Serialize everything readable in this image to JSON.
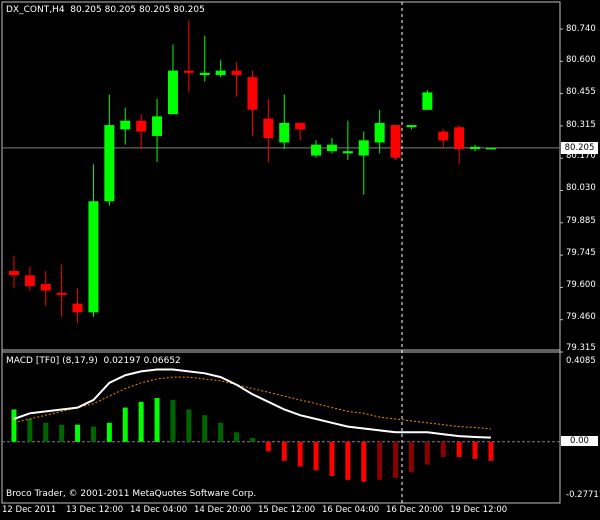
{
  "chart": {
    "symbol_line": "DX_CONT,H4  80.205 80.205 80.205 80.205",
    "current_price": "80.205",
    "price_axis": [
      "80.740",
      "80.600",
      "80.455",
      "80.315",
      "80.170",
      "80.030",
      "79.885",
      "79.745",
      "79.600",
      "79.460",
      "79.315"
    ],
    "time_axis": [
      "12 Dec 2011",
      "13 Dec 12:00",
      "14 Dec 04:00",
      "14 Dec 20:00",
      "15 Dec 12:00",
      "16 Dec 04:00",
      "16 Dec 20:00",
      "19 Dec 12:00"
    ],
    "colors": {
      "bull": "#00ff00",
      "bear": "#ff0000",
      "grid": "#808080",
      "background": "#000000"
    }
  },
  "indicator": {
    "label": "MACD [TF0] (8,17,9)  0.02197 0.06652",
    "axis": [
      "0.4085",
      "0.00",
      "-0.27711"
    ],
    "zero_label": "0.00",
    "copyright": "Broco Trader, © 2001-2011 MetaQuotes Software Corp.",
    "colors": {
      "pos_rising": "#00ff00",
      "pos_falling": "#006400",
      "neg_falling": "#ff0000",
      "neg_rising": "#8b0000",
      "macd_line": "#ffffff",
      "signal_line": "#ff8c00"
    }
  },
  "chart_data": [
    {
      "type": "candlestick",
      "title": "DX_CONT,H4",
      "ylim": [
        79.3,
        80.82
      ],
      "candles": [
        {
          "o": 79.64,
          "h": 79.71,
          "l": 79.56,
          "c": 79.62
        },
        {
          "o": 79.62,
          "h": 79.66,
          "l": 79.55,
          "c": 79.57
        },
        {
          "o": 79.58,
          "h": 79.64,
          "l": 79.48,
          "c": 79.55
        },
        {
          "o": 79.54,
          "h": 79.67,
          "l": 79.43,
          "c": 79.53
        },
        {
          "o": 79.49,
          "h": 79.56,
          "l": 79.4,
          "c": 79.45
        },
        {
          "o": 79.45,
          "h": 80.13,
          "l": 79.43,
          "c": 79.96
        },
        {
          "o": 79.96,
          "h": 80.45,
          "l": 79.94,
          "c": 80.31
        },
        {
          "o": 80.29,
          "h": 80.39,
          "l": 80.22,
          "c": 80.33
        },
        {
          "o": 80.33,
          "h": 80.36,
          "l": 80.2,
          "c": 80.28
        },
        {
          "o": 80.26,
          "h": 80.43,
          "l": 80.14,
          "c": 80.35
        },
        {
          "o": 80.36,
          "h": 80.68,
          "l": 80.36,
          "c": 80.56
        },
        {
          "o": 80.56,
          "h": 80.79,
          "l": 80.46,
          "c": 80.55
        },
        {
          "o": 80.54,
          "h": 80.72,
          "l": 80.51,
          "c": 80.55
        },
        {
          "o": 80.54,
          "h": 80.61,
          "l": 80.53,
          "c": 80.56
        },
        {
          "o": 80.56,
          "h": 80.6,
          "l": 80.44,
          "c": 80.54
        },
        {
          "o": 80.53,
          "h": 80.56,
          "l": 80.26,
          "c": 80.38
        },
        {
          "o": 80.34,
          "h": 80.43,
          "l": 80.14,
          "c": 80.25
        },
        {
          "o": 80.23,
          "h": 80.45,
          "l": 80.2,
          "c": 80.32
        },
        {
          "o": 80.32,
          "h": 80.32,
          "l": 80.24,
          "c": 80.29
        },
        {
          "o": 80.17,
          "h": 80.24,
          "l": 80.16,
          "c": 80.22
        },
        {
          "o": 80.19,
          "h": 80.25,
          "l": 80.18,
          "c": 80.22
        },
        {
          "o": 80.18,
          "h": 80.33,
          "l": 80.15,
          "c": 80.19
        },
        {
          "o": 80.17,
          "h": 80.28,
          "l": 79.99,
          "c": 80.24
        },
        {
          "o": 80.23,
          "h": 80.38,
          "l": 80.18,
          "c": 80.32
        },
        {
          "o": 80.31,
          "h": 80.31,
          "l": 80.15,
          "c": 80.16
        },
        {
          "o": 80.3,
          "h": 80.31,
          "l": 80.29,
          "c": 80.31
        },
        {
          "o": 80.38,
          "h": 80.47,
          "l": 80.38,
          "c": 80.46
        },
        {
          "o": 80.28,
          "h": 80.29,
          "l": 80.21,
          "c": 80.24
        },
        {
          "o": 80.3,
          "h": 80.31,
          "l": 80.13,
          "c": 80.2
        },
        {
          "o": 80.2,
          "h": 80.22,
          "l": 80.19,
          "c": 80.21
        },
        {
          "o": 80.205,
          "h": 80.205,
          "l": 80.205,
          "c": 80.205
        }
      ]
    },
    {
      "type": "bar",
      "title": "MACD [TF0] (8,17,9)",
      "ylim": [
        -0.285,
        0.43
      ],
      "histogram": [
        0.17,
        0.12,
        0.1,
        0.09,
        0.09,
        0.08,
        0.1,
        0.18,
        0.21,
        0.23,
        0.22,
        0.17,
        0.14,
        0.1,
        0.05,
        0.02,
        -0.05,
        -0.1,
        -0.13,
        -0.15,
        -0.18,
        -0.2,
        -0.21,
        -0.2,
        -0.19,
        -0.16,
        -0.12,
        -0.08,
        -0.08,
        -0.09,
        -0.1
      ],
      "macd": [
        0.12,
        0.15,
        0.16,
        0.17,
        0.18,
        0.22,
        0.31,
        0.35,
        0.37,
        0.38,
        0.38,
        0.37,
        0.36,
        0.34,
        0.3,
        0.25,
        0.21,
        0.17,
        0.14,
        0.12,
        0.1,
        0.08,
        0.07,
        0.06,
        0.05,
        0.05,
        0.05,
        0.04,
        0.03,
        0.025,
        0.022
      ],
      "signal": [
        0.1,
        0.12,
        0.14,
        0.16,
        0.18,
        0.2,
        0.24,
        0.28,
        0.31,
        0.33,
        0.34,
        0.34,
        0.33,
        0.32,
        0.3,
        0.28,
        0.26,
        0.24,
        0.22,
        0.2,
        0.18,
        0.16,
        0.15,
        0.13,
        0.12,
        0.11,
        0.1,
        0.09,
        0.08,
        0.075,
        0.067
      ]
    }
  ]
}
